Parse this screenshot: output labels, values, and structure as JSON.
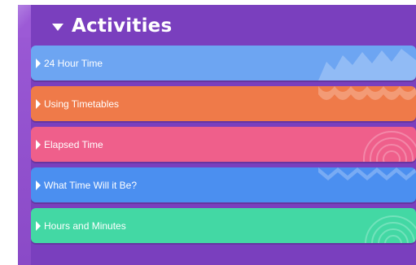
{
  "header": {
    "title": "Activities"
  },
  "colors": {
    "panel": "#7a3fbe",
    "row_1": "#6da5f2",
    "row_2": "#ef7a49",
    "row_3": "#ef5f8b",
    "row_4": "#4b8ff0",
    "row_5": "#43d8a4"
  },
  "activities": [
    {
      "label": "24 Hour Time"
    },
    {
      "label": "Using Timetables"
    },
    {
      "label": "Elapsed Time"
    },
    {
      "label": "What Time Will it Be?"
    },
    {
      "label": "Hours and Minutes"
    }
  ]
}
